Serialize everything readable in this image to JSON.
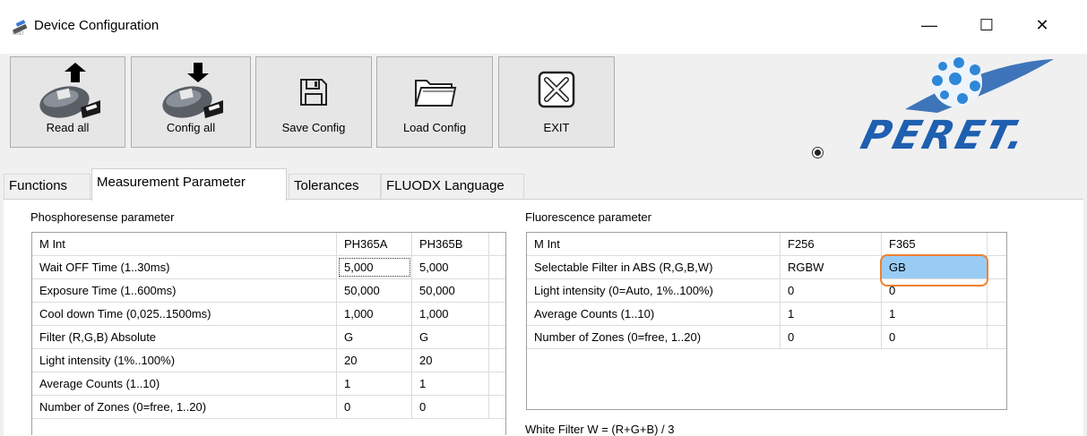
{
  "window": {
    "title": "Device Configuration",
    "icon": "satellite-icon",
    "controls": [
      "—",
      "☐",
      "✕"
    ]
  },
  "toolbar": {
    "buttons": [
      {
        "label": "Read all",
        "icon": "device-upload-icon"
      },
      {
        "label": "Config all",
        "icon": "device-download-icon"
      },
      {
        "label": "Save Config",
        "icon": "floppy-disk-icon"
      },
      {
        "label": "Load Config",
        "icon": "folder-icon"
      },
      {
        "label": "EXIT",
        "icon": "close-box-icon"
      }
    ],
    "logo_text": "PERET."
  },
  "tabs": [
    {
      "label": "Functions",
      "active": false
    },
    {
      "label": "Measurement Parameter",
      "active": true
    },
    {
      "label": "Tolerances",
      "active": false
    },
    {
      "label": "FLUODX Language",
      "active": false
    }
  ],
  "phosphorescence": {
    "title": "Phosphoresense parameter",
    "columns": [
      "M Int",
      "PH365A",
      "PH365B"
    ],
    "rows": [
      [
        "Wait OFF Time (1..30ms)",
        "5,000",
        "5,000"
      ],
      [
        "Exposure Time (1..600ms)",
        "50,000",
        "50,000"
      ],
      [
        "Cool down Time (0,025..1500ms)",
        "1,000",
        "1,000"
      ],
      [
        "Filter (R,G,B) Absolute",
        "G",
        "G"
      ],
      [
        "Light intensity (1%..100%)",
        "20",
        "20"
      ],
      [
        "Average Counts (1..10)",
        "1",
        "1"
      ],
      [
        "Number of Zones (0=free, 1..20)",
        "0",
        "0"
      ]
    ]
  },
  "fluorescence": {
    "title": "Fluorescence parameter",
    "columns": [
      "M Int",
      "F256",
      "F365"
    ],
    "rows": [
      [
        "Selectable Filter in ABS (R,G,B,W)",
        "RGBW",
        "GB"
      ],
      [
        "Light intensity (0=Auto, 1%..100%)",
        "0",
        "0"
      ],
      [
        "Average Counts (1..10)",
        "1",
        "1"
      ],
      [
        "Number of Zones (0=free, 1..20)",
        "0",
        "0"
      ]
    ],
    "footnote": "White Filter W = (R+G+B) / 3"
  },
  "colors": {
    "selected_cell": "#99ccf5",
    "highlight_ring": "#f08030",
    "logo_blue": "#1e5fb0"
  }
}
